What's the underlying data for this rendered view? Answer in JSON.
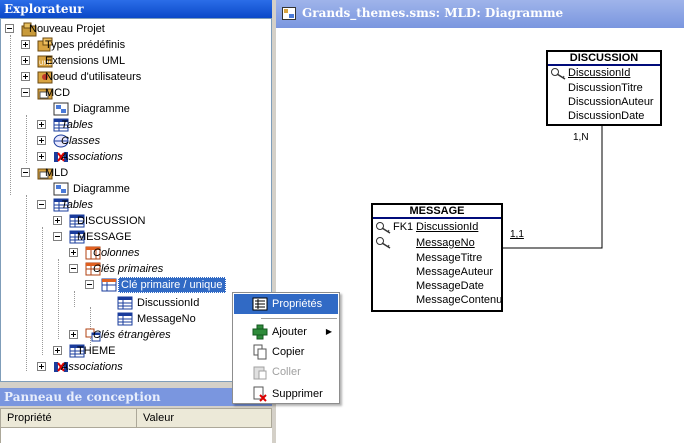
{
  "explorer": {
    "title": "Explorateur",
    "tree": [
      {
        "label": "Nouveau Projet",
        "icon": "project-icon",
        "italic": false
      },
      {
        "label": "Types prédéfinis",
        "icon": "types-icon",
        "italic": false
      },
      {
        "label": "Extensions UML",
        "icon": "uml-icon",
        "italic": false
      },
      {
        "label": "Noeud d'utilisateurs",
        "icon": "user-node-icon",
        "italic": false
      },
      {
        "label": "MCD",
        "icon": "folder-icon",
        "italic": false
      },
      {
        "label": "Diagramme",
        "icon": "diagram-icon",
        "italic": false
      },
      {
        "label": "Tables",
        "icon": "table-icon",
        "italic": true
      },
      {
        "label": "Classes",
        "icon": "class-icon",
        "italic": true
      },
      {
        "label": "Associations",
        "icon": "association-icon",
        "italic": true
      },
      {
        "label": "MLD",
        "icon": "folder-icon",
        "italic": false
      },
      {
        "label": "Diagramme",
        "icon": "diagram-icon",
        "italic": false
      },
      {
        "label": "Tables",
        "icon": "table-icon",
        "italic": true
      },
      {
        "label": "DISCUSSION",
        "icon": "table-icon",
        "italic": false
      },
      {
        "label": "MESSAGE",
        "icon": "table-icon",
        "italic": false
      },
      {
        "label": "Colonnes",
        "icon": "columns-icon",
        "italic": true
      },
      {
        "label": "Clés primaires",
        "icon": "primary-keys-icon",
        "italic": true
      },
      {
        "label": "Clé primaire / unique",
        "icon": "key-table-icon",
        "italic": false,
        "selected": true
      },
      {
        "label": "DiscussionId",
        "icon": "table-icon",
        "italic": false
      },
      {
        "label": "MessageNo",
        "icon": "table-icon",
        "italic": false
      },
      {
        "label": "Clés étrangères",
        "icon": "foreign-keys-icon",
        "italic": true
      },
      {
        "label": "THEME",
        "icon": "table-icon",
        "italic": false
      },
      {
        "label": "Associations",
        "icon": "association-icon",
        "italic": true
      }
    ]
  },
  "design_panel": {
    "title": "Panneau de conception",
    "col_property": "Propriété",
    "col_value": "Valeur"
  },
  "diagram": {
    "title": "Grands_themes.sms: MLD: Diagramme",
    "entities": {
      "discussion": {
        "name": "DISCUSSION",
        "fields": [
          "DiscussionId",
          "DiscussionTitre",
          "DiscussionAuteur",
          "DiscussionDate"
        ]
      },
      "message": {
        "name": "MESSAGE",
        "fk_label": "FK1",
        "fields": [
          "DiscussionId",
          "MessageNo",
          "MessageTitre",
          "MessageAuteur",
          "MessageDate",
          "MessageContenu"
        ]
      }
    },
    "cardinality_top": "1,N",
    "cardinality_side": "1,1"
  },
  "context_menu": {
    "items": [
      {
        "label": "Propriétés",
        "icon": "properties-icon"
      },
      {
        "label": "Ajouter",
        "icon": "add-icon"
      },
      {
        "label": "Copier",
        "icon": "copy-icon"
      },
      {
        "label": "Coller",
        "icon": "paste-icon"
      },
      {
        "label": "Supprimer",
        "icon": "delete-icon"
      }
    ],
    "submenu_arrow": "▶"
  },
  "colors": {
    "title_active": "#0a54e0",
    "title_inactive": "#7a96df",
    "selection": "#316ac5",
    "entity_header_line": "#000b7a"
  }
}
